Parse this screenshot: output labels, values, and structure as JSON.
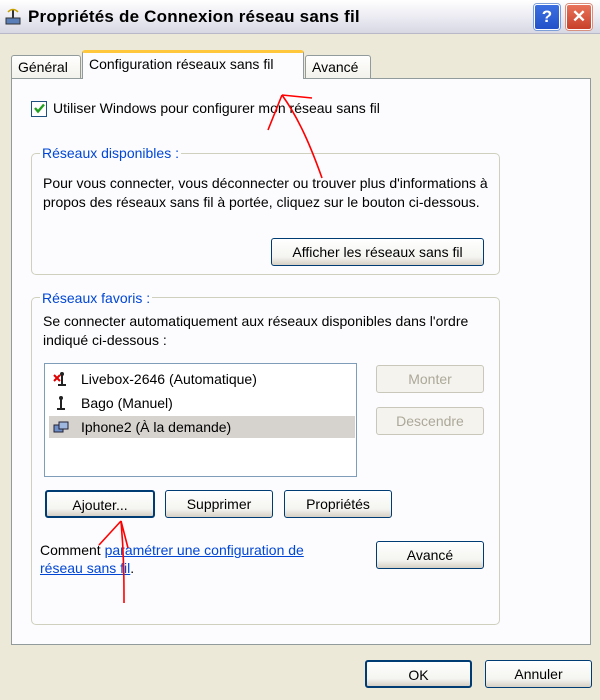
{
  "window": {
    "title": "Propriétés de Connexion réseau sans fil",
    "help_label": "?",
    "close_label": "✕"
  },
  "tabs": [
    {
      "label": "Général",
      "active": false
    },
    {
      "label": "Configuration réseaux sans fil",
      "active": true
    },
    {
      "label": "Avancé",
      "active": false
    }
  ],
  "use_windows_checkbox": {
    "label": "Utiliser Windows pour configurer mon réseau sans fil",
    "checked": true
  },
  "available_networks": {
    "legend": "Réseaux disponibles :",
    "description": "Pour vous connecter, vous déconnecter ou trouver plus d'informations à propos des réseaux sans fil à portée, cliquez sur le bouton ci-dessous.",
    "show_button": "Afficher les réseaux sans fil"
  },
  "preferred_networks": {
    "legend": "Réseaux favoris :",
    "description": "Se connecter automatiquement aux réseaux disponibles dans l'ordre indiqué ci-dessous :",
    "items": [
      {
        "label": "Livebox-2646 (Automatique)",
        "icon": "network-antenna-red-x-icon"
      },
      {
        "label": "Bago (Manuel)",
        "icon": "network-antenna-icon"
      },
      {
        "label": "Iphone2 (À la demande)",
        "icon": "adhoc-network-icon"
      }
    ],
    "move_up_button": "Monter",
    "move_down_button": "Descendre",
    "add_button": "Ajouter...",
    "remove_button": "Supprimer",
    "properties_button": "Propriétés"
  },
  "footer": {
    "comment_prefix": "Comment ",
    "comment_link": "paramétrer une configuration de réseau sans fil",
    "comment_suffix": ".",
    "advanced_button": "Avancé"
  },
  "dialog_buttons": {
    "ok": "OK",
    "cancel": "Annuler"
  },
  "colors": {
    "background": "#ECE9D8",
    "legend_blue": "#0046D5",
    "annotation_red": "#FF0000"
  }
}
